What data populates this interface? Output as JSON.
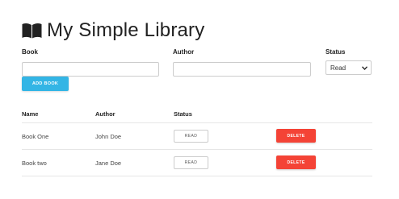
{
  "header": {
    "icon": "book-open-icon",
    "title": "My Simple Library"
  },
  "form": {
    "book": {
      "label": "Book",
      "value": "",
      "placeholder": ""
    },
    "author": {
      "label": "Author",
      "value": "",
      "placeholder": ""
    },
    "status": {
      "label": "Status",
      "selected": "Read"
    },
    "add_button_label": "Add Book"
  },
  "table": {
    "headers": {
      "name": "Name",
      "author": "Author",
      "status": "Status"
    },
    "rows": [
      {
        "name": "Book One",
        "author": "John Doe",
        "status_label": "Read",
        "delete_label": "Delete"
      },
      {
        "name": "Book two",
        "author": "Jane Doe",
        "status_label": "Read",
        "delete_label": "Delete"
      }
    ]
  },
  "colors": {
    "accent": "#33b5e5",
    "danger": "#f44336"
  }
}
